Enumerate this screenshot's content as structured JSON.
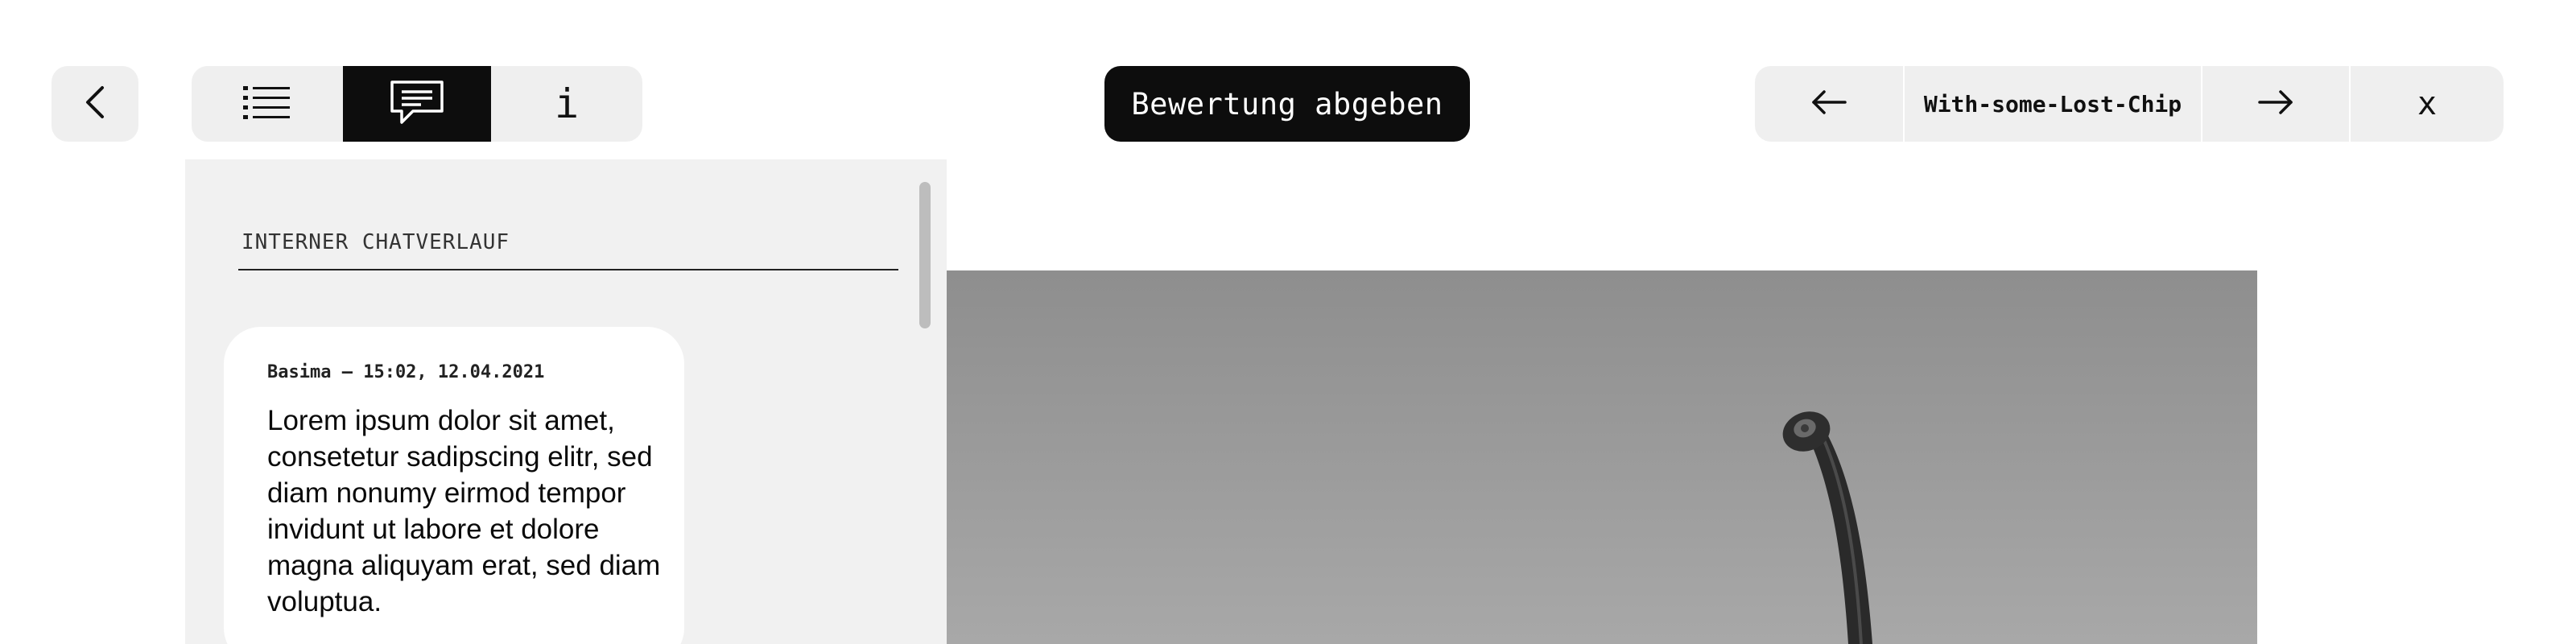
{
  "toolbar": {
    "back_icon": "chevron-left-icon",
    "view_toggle": [
      {
        "id": "list",
        "icon": "list-icon",
        "active": false
      },
      {
        "id": "chat",
        "icon": "chat-bubble-icon",
        "active": true
      },
      {
        "id": "info",
        "icon": "info-icon",
        "label": "i",
        "active": false
      }
    ],
    "rate_button_label": "Bewertung abgeben",
    "navigation": {
      "prev_icon": "arrow-left-icon",
      "item_name": "With-some-Lost-Chip",
      "next_icon": "arrow-right-icon",
      "close_label": "x"
    }
  },
  "chat": {
    "heading": "INTERNER CHATVERLAUF",
    "messages": [
      {
        "meta": "Basima – 15:02, 12.04.2021",
        "text": "Lorem ipsum dolor sit amet, consetetur sadipscing elitr, sed diam nonumy eirmod tempor invidunt ut labore et dolore magna aliquyam erat, sed diam voluptua."
      }
    ]
  },
  "image": {
    "description_icon": "sculpture-photo"
  },
  "colors": {
    "background": "#ffffff",
    "pill": "#efefef",
    "active": "#0d0d0d",
    "panel": "#f1f1f1"
  }
}
